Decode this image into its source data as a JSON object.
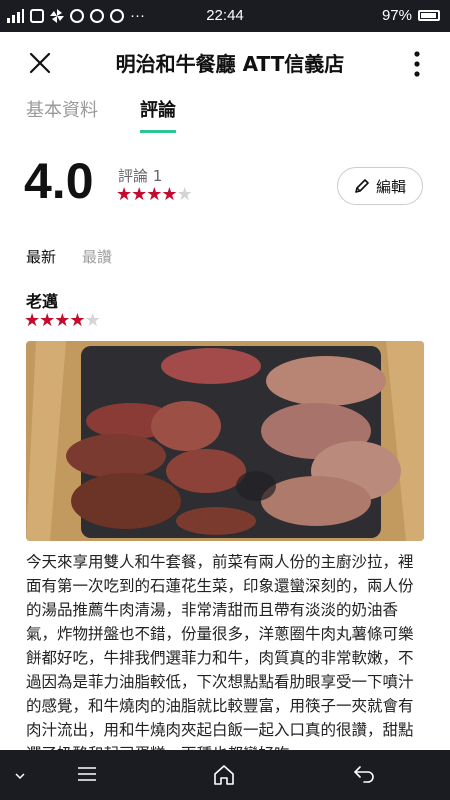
{
  "status_bar": {
    "time": "22:44",
    "battery": "97%",
    "icons": [
      "signal-icon",
      "g-icon",
      "pinwheel-icon",
      "chrome-icon",
      "google-icon",
      "line-icon",
      "more-dots-icon"
    ]
  },
  "header": {
    "title": "明治和牛餐廳 ATT信義店"
  },
  "tabs": [
    {
      "label": "基本資料",
      "active": false
    },
    {
      "label": "評論",
      "active": true
    }
  ],
  "rating": {
    "score": "4.0",
    "count_label": "評論 1",
    "stars": 4,
    "max_stars": 5
  },
  "edit_button": {
    "label": "編輯"
  },
  "sort_tabs": [
    {
      "label": "最新",
      "active": true
    },
    {
      "label": "最讚",
      "active": false
    }
  ],
  "review": {
    "author": "老邁",
    "stars": 4,
    "text": "今天來享用雙人和牛套餐，前菜有兩人份的主廚沙拉，裡面有第一次吃到的石蓮花生菜，印象還蠻深刻的，兩人份的湯品推薦牛肉清湯，非常清甜而且帶有淡淡的奶油香氣，炸物拼盤也不錯，份量很多，洋蔥圈牛肉丸薯條可樂餅都好吃，牛排我們選菲力和牛，肉質真的非常軟嫩，不過因為是菲力油脂較低，下次想點點看肋眼享受一下噴汁的感覺，和牛燒肉的油脂就比較豐富，用筷子一夾就會有肉汁流出，用和牛燒肉夾起白飯一起入口真的很讚，甜點選了奶酪和起司蛋糕，兩種也都蠻好吃"
  },
  "colors": {
    "star_active": "#c40b2e",
    "tab_underline": "#2ec49a",
    "status_bar_bg": "#1a1c22"
  }
}
